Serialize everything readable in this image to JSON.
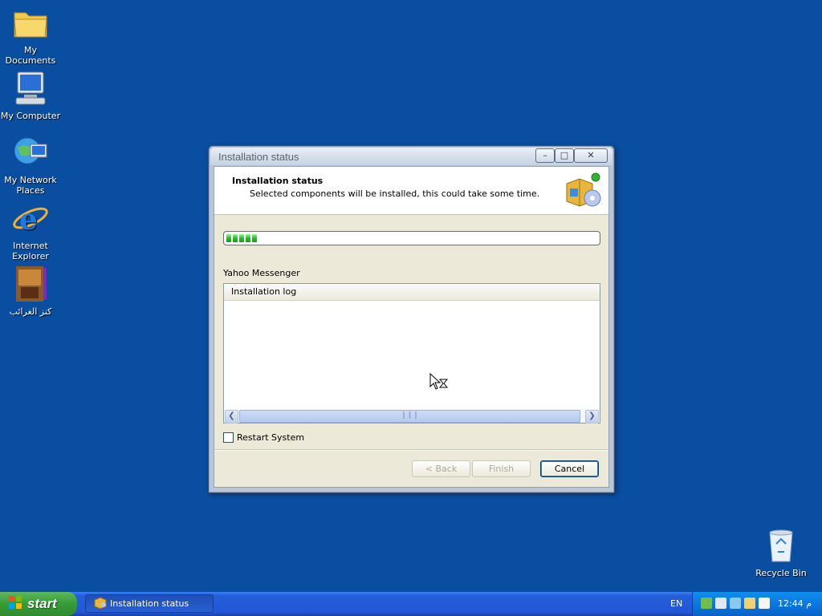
{
  "desktop": {
    "icons": [
      {
        "label": "My Documents"
      },
      {
        "label": "My Computer"
      },
      {
        "label": "My Network Places"
      },
      {
        "label": "Internet Explorer"
      },
      {
        "label": "كنز الغرائب"
      },
      {
        "label": "Recycle Bin"
      }
    ]
  },
  "window": {
    "title": "Installation status",
    "header_title": "Installation status",
    "header_subtitle": "Selected components will be installed, this could take some time.",
    "progress_fraction": 0.09,
    "component": "Yahoo Messenger",
    "log_header": "Installation log",
    "restart_label": "Restart System",
    "buttons": {
      "back": "< Back",
      "finish": "Finish",
      "cancel": "Cancel"
    }
  },
  "taskbar": {
    "start_label": "start",
    "task_label": "Installation status",
    "language": "EN",
    "clock": "12:44 م"
  },
  "colors": {
    "desktop": "#0a4ea1",
    "taskbar": "#245edb",
    "start": "#389e38",
    "progress": "#2fb52f"
  }
}
